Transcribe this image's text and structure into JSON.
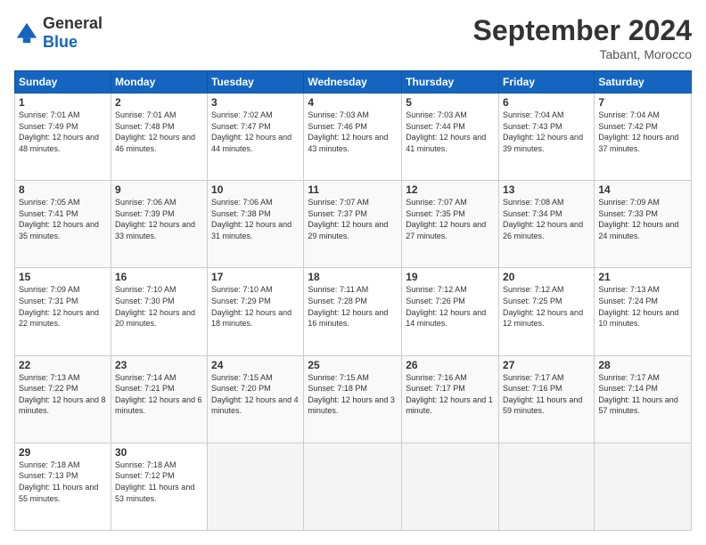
{
  "header": {
    "logo_general": "General",
    "logo_blue": "Blue",
    "title": "September 2024",
    "location": "Tabant, Morocco"
  },
  "weekdays": [
    "Sunday",
    "Monday",
    "Tuesday",
    "Wednesday",
    "Thursday",
    "Friday",
    "Saturday"
  ],
  "weeks": [
    [
      {
        "day": "1",
        "sunrise": "7:01 AM",
        "sunset": "7:49 PM",
        "daylight": "12 hours and 48 minutes."
      },
      {
        "day": "2",
        "sunrise": "7:01 AM",
        "sunset": "7:48 PM",
        "daylight": "12 hours and 46 minutes."
      },
      {
        "day": "3",
        "sunrise": "7:02 AM",
        "sunset": "7:47 PM",
        "daylight": "12 hours and 44 minutes."
      },
      {
        "day": "4",
        "sunrise": "7:03 AM",
        "sunset": "7:46 PM",
        "daylight": "12 hours and 43 minutes."
      },
      {
        "day": "5",
        "sunrise": "7:03 AM",
        "sunset": "7:44 PM",
        "daylight": "12 hours and 41 minutes."
      },
      {
        "day": "6",
        "sunrise": "7:04 AM",
        "sunset": "7:43 PM",
        "daylight": "12 hours and 39 minutes."
      },
      {
        "day": "7",
        "sunrise": "7:04 AM",
        "sunset": "7:42 PM",
        "daylight": "12 hours and 37 minutes."
      }
    ],
    [
      {
        "day": "8",
        "sunrise": "7:05 AM",
        "sunset": "7:41 PM",
        "daylight": "12 hours and 35 minutes."
      },
      {
        "day": "9",
        "sunrise": "7:06 AM",
        "sunset": "7:39 PM",
        "daylight": "12 hours and 33 minutes."
      },
      {
        "day": "10",
        "sunrise": "7:06 AM",
        "sunset": "7:38 PM",
        "daylight": "12 hours and 31 minutes."
      },
      {
        "day": "11",
        "sunrise": "7:07 AM",
        "sunset": "7:37 PM",
        "daylight": "12 hours and 29 minutes."
      },
      {
        "day": "12",
        "sunrise": "7:07 AM",
        "sunset": "7:35 PM",
        "daylight": "12 hours and 27 minutes."
      },
      {
        "day": "13",
        "sunrise": "7:08 AM",
        "sunset": "7:34 PM",
        "daylight": "12 hours and 26 minutes."
      },
      {
        "day": "14",
        "sunrise": "7:09 AM",
        "sunset": "7:33 PM",
        "daylight": "12 hours and 24 minutes."
      }
    ],
    [
      {
        "day": "15",
        "sunrise": "7:09 AM",
        "sunset": "7:31 PM",
        "daylight": "12 hours and 22 minutes."
      },
      {
        "day": "16",
        "sunrise": "7:10 AM",
        "sunset": "7:30 PM",
        "daylight": "12 hours and 20 minutes."
      },
      {
        "day": "17",
        "sunrise": "7:10 AM",
        "sunset": "7:29 PM",
        "daylight": "12 hours and 18 minutes."
      },
      {
        "day": "18",
        "sunrise": "7:11 AM",
        "sunset": "7:28 PM",
        "daylight": "12 hours and 16 minutes."
      },
      {
        "day": "19",
        "sunrise": "7:12 AM",
        "sunset": "7:26 PM",
        "daylight": "12 hours and 14 minutes."
      },
      {
        "day": "20",
        "sunrise": "7:12 AM",
        "sunset": "7:25 PM",
        "daylight": "12 hours and 12 minutes."
      },
      {
        "day": "21",
        "sunrise": "7:13 AM",
        "sunset": "7:24 PM",
        "daylight": "12 hours and 10 minutes."
      }
    ],
    [
      {
        "day": "22",
        "sunrise": "7:13 AM",
        "sunset": "7:22 PM",
        "daylight": "12 hours and 8 minutes."
      },
      {
        "day": "23",
        "sunrise": "7:14 AM",
        "sunset": "7:21 PM",
        "daylight": "12 hours and 6 minutes."
      },
      {
        "day": "24",
        "sunrise": "7:15 AM",
        "sunset": "7:20 PM",
        "daylight": "12 hours and 4 minutes."
      },
      {
        "day": "25",
        "sunrise": "7:15 AM",
        "sunset": "7:18 PM",
        "daylight": "12 hours and 3 minutes."
      },
      {
        "day": "26",
        "sunrise": "7:16 AM",
        "sunset": "7:17 PM",
        "daylight": "12 hours and 1 minute."
      },
      {
        "day": "27",
        "sunrise": "7:17 AM",
        "sunset": "7:16 PM",
        "daylight": "11 hours and 59 minutes."
      },
      {
        "day": "28",
        "sunrise": "7:17 AM",
        "sunset": "7:14 PM",
        "daylight": "11 hours and 57 minutes."
      }
    ],
    [
      {
        "day": "29",
        "sunrise": "7:18 AM",
        "sunset": "7:13 PM",
        "daylight": "11 hours and 55 minutes."
      },
      {
        "day": "30",
        "sunrise": "7:18 AM",
        "sunset": "7:12 PM",
        "daylight": "11 hours and 53 minutes."
      },
      null,
      null,
      null,
      null,
      null
    ]
  ]
}
